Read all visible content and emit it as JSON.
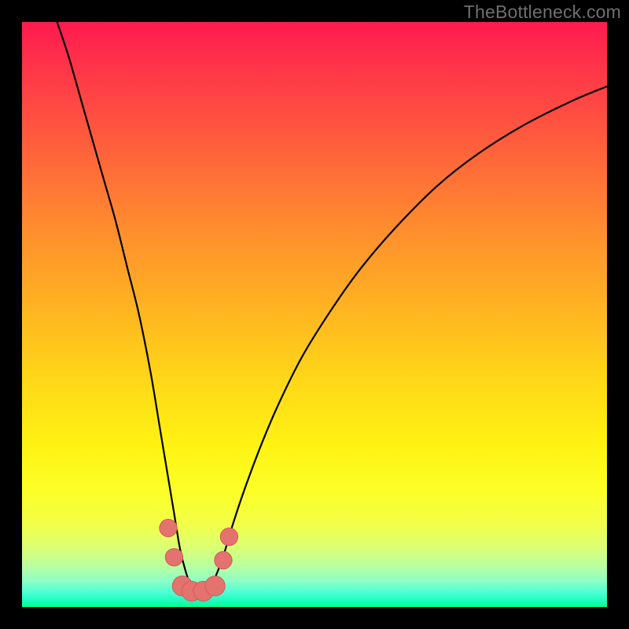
{
  "watermark": "TheBottleneck.com",
  "colors": {
    "frame": "#000000",
    "gradient_top": "#ff1a4f",
    "gradient_bottom": "#06ff93",
    "curve": "#000000",
    "marker_fill": "#e4736f",
    "marker_stroke": "#cf5d59"
  },
  "chart_data": {
    "type": "line",
    "title": "",
    "xlabel": "",
    "ylabel": "",
    "xlim": [
      0,
      100
    ],
    "ylim": [
      0,
      100
    ],
    "grid": false,
    "legend": false,
    "series": [
      {
        "name": "bottleneck-curve",
        "x": [
          6,
          8,
          10,
          12,
          14,
          16,
          18,
          20,
          22,
          23.5,
          25,
          26,
          27,
          28,
          29,
          30,
          31,
          32,
          33,
          34.5,
          36,
          38,
          41,
          44,
          48,
          53,
          58,
          64,
          71,
          78,
          86,
          94,
          100
        ],
        "y": [
          100,
          94,
          87,
          80,
          73,
          66,
          58,
          50,
          40,
          31,
          22,
          16,
          10,
          6,
          3.4,
          2.6,
          2.6,
          3.2,
          5,
          9,
          14,
          20,
          28,
          35,
          43,
          51,
          58,
          65,
          72,
          77.5,
          82.5,
          86.5,
          89
        ]
      }
    ],
    "markers": [
      {
        "x": 25.0,
        "y": 13.5,
        "r": 1.5
      },
      {
        "x": 26.0,
        "y": 8.5,
        "r": 1.5
      },
      {
        "x": 27.4,
        "y": 3.6,
        "r": 1.7
      },
      {
        "x": 29.0,
        "y": 2.7,
        "r": 1.7
      },
      {
        "x": 31.0,
        "y": 2.7,
        "r": 1.7
      },
      {
        "x": 33.0,
        "y": 3.6,
        "r": 1.7
      },
      {
        "x": 34.4,
        "y": 8.0,
        "r": 1.5
      },
      {
        "x": 35.4,
        "y": 12.0,
        "r": 1.5
      }
    ]
  }
}
